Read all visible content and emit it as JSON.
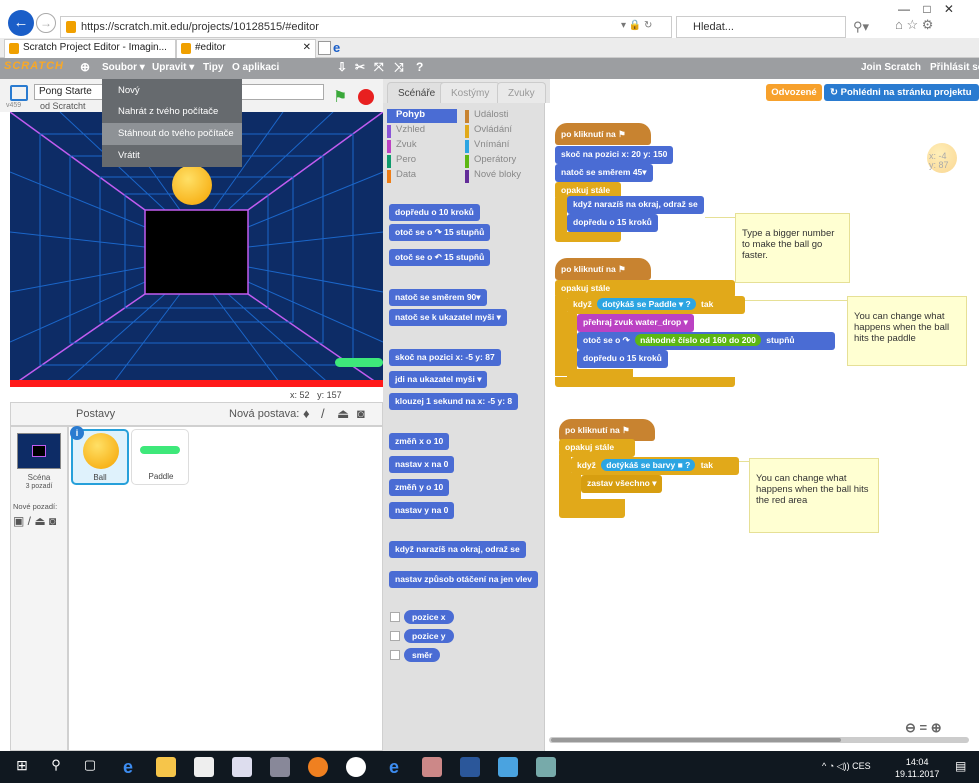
{
  "browser": {
    "url": "https://scratch.mit.edu/projects/10128515/#editor",
    "search_placeholder": "Hledat...",
    "tabs": [
      {
        "label": "Scratch Project Editor - Imagin..."
      },
      {
        "label": "#editor"
      }
    ]
  },
  "menubar": {
    "logo": "SCRATCH",
    "file": "Soubor ▾",
    "edit": "Upravit ▾",
    "tips": "Tipy",
    "about": "O aplikaci",
    "join": "Join Scratch",
    "signin": "Přihlásit se"
  },
  "file_menu": [
    "Nový",
    "Nahrát z tvého počítače",
    "Stáhnout do tvého počítače",
    "Vrátit"
  ],
  "stage": {
    "project_title": "Pong Starte",
    "author": "od Scratcht",
    "version": "v459",
    "x_label": "x:",
    "x": "52",
    "y_label": "y:",
    "y": "157"
  },
  "sprites": {
    "header": "Postavy",
    "new_sprite": "Nová postava:",
    "stage_label": "Scéna",
    "stage_backdrops": "3 pozadí",
    "new_backdrop": "Nové pozadí:",
    "items": [
      {
        "name": "Ball"
      },
      {
        "name": "Paddle"
      }
    ]
  },
  "palette": {
    "tabs": [
      "Scénáře",
      "Kostýmy",
      "Zvuky"
    ],
    "categories": [
      {
        "name": "Pohyb",
        "color": "#4a6cd4"
      },
      {
        "name": "Vzhled",
        "color": "#8a55d7"
      },
      {
        "name": "Zvuk",
        "color": "#bb42c3"
      },
      {
        "name": "Pero",
        "color": "#0e9a6c"
      },
      {
        "name": "Data",
        "color": "#ee7d16"
      },
      {
        "name": "Události",
        "color": "#c88330"
      },
      {
        "name": "Ovládání",
        "color": "#e1a91a"
      },
      {
        "name": "Vnímání",
        "color": "#2ca5e2"
      },
      {
        "name": "Operátory",
        "color": "#5cb712"
      },
      {
        "name": "Nové bloky",
        "color": "#632d99"
      }
    ],
    "blocks": [
      "dopředu o 10 kroků",
      "otoč se o ↷ 15 stupňů",
      "otoč se o ↶ 15 stupňů",
      "natoč se směrem 90▾",
      "natoč se k ukazatel myši ▾",
      "skoč na pozici x: -5 y: 87",
      "jdi na ukazatel myši ▾",
      "klouzej 1 sekund na x: -5 y: 8",
      "změň x o 10",
      "nastav x na 0",
      "změň y o 10",
      "nastav y na 0",
      "když narazíš na okraj, odraž se",
      "nastav způsob otáčení na jen vlev"
    ],
    "reporters": [
      "pozice x",
      "pozice y",
      "směr"
    ]
  },
  "topbar": {
    "remix": "Odvozené",
    "see_project": "Pohlédni na stránku projektu"
  },
  "scripts": {
    "sprite_x": "x: -4",
    "sprite_y": "y: 87",
    "s1": [
      "po kliknutí na ⚑",
      "skoč na pozici x: 20 y: 150",
      "natoč se směrem 45▾",
      "opakuj stále",
      "když narazíš na okraj, odraž se",
      "dopředu o 15 kroků"
    ],
    "s2": [
      "po kliknutí na ⚑",
      "opakuj stále",
      "když",
      "dotýkáš se Paddle ▾ ?",
      "tak",
      "přehraj zvuk water_drop ▾",
      "otoč se o ↷",
      "náhodné číslo od 160 do 200",
      "stupňů",
      "dopředu o 15 kroků"
    ],
    "s3": [
      "po kliknutí na ⚑",
      "opakuj stále",
      "když",
      "dotýkáš se barvy ■ ?",
      "tak",
      "zastav všechno ▾"
    ],
    "notes": [
      "Type a bigger number to make the ball go faster.",
      "You can change what happens when the ball hits the paddle",
      "You can change what happens when the ball hits the red area"
    ]
  },
  "taskbar": {
    "time": "14:04",
    "date": "19.11.2017",
    "lang": "CES"
  }
}
